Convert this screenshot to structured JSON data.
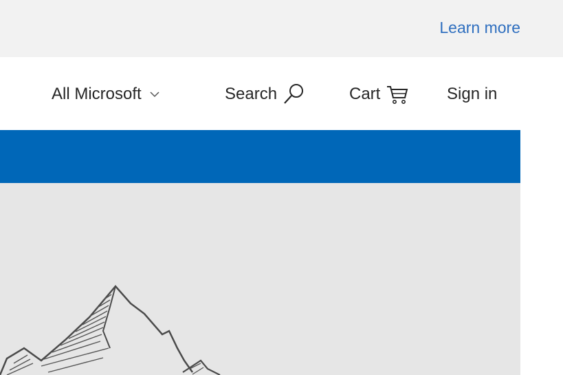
{
  "notice": {
    "link_label": "Learn more"
  },
  "nav": {
    "all_microsoft": "All Microsoft",
    "search": "Search",
    "cart": "Cart",
    "sign_in": "Sign in"
  },
  "icons": {
    "chevron": "chevron-down-icon",
    "search": "search-icon",
    "cart": "cart-icon"
  },
  "colors": {
    "link": "#2f6fbf",
    "brand_blue": "#0067b8",
    "notice_bg": "#f2f2f2",
    "hero_bg": "#e6e6e6"
  }
}
